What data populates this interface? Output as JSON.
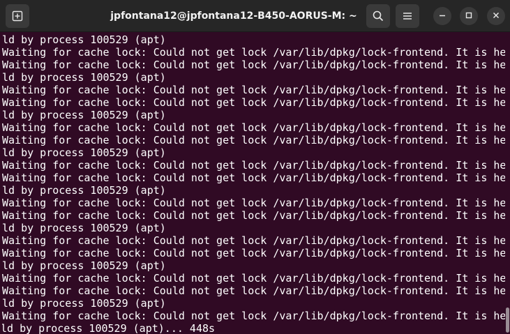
{
  "window": {
    "title": "jpfontana12@jpfontana12-B450-AORUS-M: ~"
  },
  "icons": {
    "new_tab": "new-tab-icon",
    "search": "search-icon",
    "menu": "hamburger-menu-icon",
    "minimize": "minimize-icon",
    "maximize": "maximize-icon",
    "close": "close-icon"
  },
  "colors": {
    "terminal_bg": "#300a24",
    "titlebar_bg": "#262626",
    "text": "#ffffff"
  },
  "terminal": {
    "lines": [
      "ld by process 100529 (apt)",
      "Waiting for cache lock: Could not get lock /var/lib/dpkg/lock-frontend. It is he",
      "Waiting for cache lock: Could not get lock /var/lib/dpkg/lock-frontend. It is he",
      "ld by process 100529 (apt)",
      "Waiting for cache lock: Could not get lock /var/lib/dpkg/lock-frontend. It is he",
      "Waiting for cache lock: Could not get lock /var/lib/dpkg/lock-frontend. It is he",
      "ld by process 100529 (apt)",
      "Waiting for cache lock: Could not get lock /var/lib/dpkg/lock-frontend. It is he",
      "Waiting for cache lock: Could not get lock /var/lib/dpkg/lock-frontend. It is he",
      "ld by process 100529 (apt)",
      "Waiting for cache lock: Could not get lock /var/lib/dpkg/lock-frontend. It is he",
      "Waiting for cache lock: Could not get lock /var/lib/dpkg/lock-frontend. It is he",
      "ld by process 100529 (apt)",
      "Waiting for cache lock: Could not get lock /var/lib/dpkg/lock-frontend. It is he",
      "Waiting for cache lock: Could not get lock /var/lib/dpkg/lock-frontend. It is he",
      "ld by process 100529 (apt)",
      "Waiting for cache lock: Could not get lock /var/lib/dpkg/lock-frontend. It is he",
      "Waiting for cache lock: Could not get lock /var/lib/dpkg/lock-frontend. It is he",
      "ld by process 100529 (apt)",
      "Waiting for cache lock: Could not get lock /var/lib/dpkg/lock-frontend. It is he",
      "Waiting for cache lock: Could not get lock /var/lib/dpkg/lock-frontend. It is he",
      "ld by process 100529 (apt)",
      "Waiting for cache lock: Could not get lock /var/lib/dpkg/lock-frontend. It is he",
      "ld by process 100529 (apt)... 448s"
    ]
  }
}
